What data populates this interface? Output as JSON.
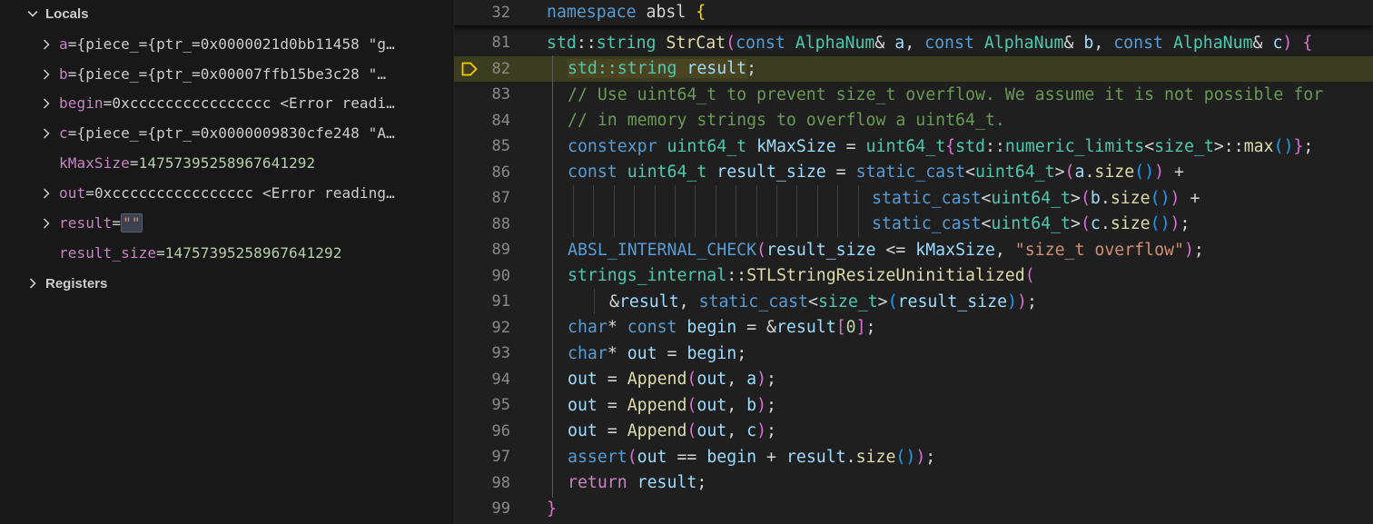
{
  "variables": {
    "locals_label": "Locals",
    "registers_label": "Registers",
    "rows": [
      {
        "name": "a",
        "eq": " = ",
        "value": "{piece_={ptr_=0x0000021d0bb11458 \"g…",
        "expandable": true
      },
      {
        "name": "b",
        "eq": " = ",
        "value": "{piece_={ptr_=0x00007ffb15be3c28 \"…",
        "expandable": true
      },
      {
        "name": "begin",
        "eq": " = ",
        "value": "0xcccccccccccccccc <Error readi…",
        "expandable": true
      },
      {
        "name": "c",
        "eq": " = ",
        "value": "{piece_={ptr_=0x0000009830cfe248 \"A…",
        "expandable": true
      },
      {
        "name": "kMaxSize",
        "eq": " = ",
        "value": "14757395258967641292",
        "expandable": false
      },
      {
        "name": "out",
        "eq": " = ",
        "value": "0xcccccccccccccccc <Error reading…",
        "expandable": true
      },
      {
        "name": "result",
        "eq": " = ",
        "value": "\"\"",
        "expandable": true
      },
      {
        "name": "result_size",
        "eq": " = ",
        "value": "14757395258967641292",
        "expandable": false
      }
    ]
  },
  "editor": {
    "sticky": {
      "num": "32",
      "t": [
        "namespace",
        " absl ",
        "{"
      ]
    },
    "lines": [
      {
        "num": "81"
      },
      {
        "num": "82"
      },
      {
        "num": "83"
      },
      {
        "num": "84"
      },
      {
        "num": "85"
      },
      {
        "num": "86"
      },
      {
        "num": "87"
      },
      {
        "num": "88"
      },
      {
        "num": "89"
      },
      {
        "num": "90"
      },
      {
        "num": "91"
      },
      {
        "num": "92"
      },
      {
        "num": "93"
      },
      {
        "num": "94"
      },
      {
        "num": "95"
      },
      {
        "num": "96"
      },
      {
        "num": "97"
      },
      {
        "num": "98"
      },
      {
        "num": "99"
      }
    ],
    "code": {
      "l81": [
        "std",
        "::",
        "string",
        " ",
        "StrCat",
        "(",
        "const",
        " ",
        "AlphaNum",
        "& ",
        "a",
        ", ",
        "const",
        " ",
        "AlphaNum",
        "& ",
        "b",
        ", ",
        "const",
        " ",
        "AlphaNum",
        "& ",
        "c",
        ") ",
        "{"
      ],
      "l82": [
        "std::string",
        " ",
        "result",
        ";"
      ],
      "l83": [
        "// Use uint64_t to prevent size_t overflow. We assume it is not possible for"
      ],
      "l84": [
        "// in memory strings to overflow a uint64_t."
      ],
      "l85": [
        "constexpr",
        " ",
        "uint64_t",
        " ",
        "kMaxSize",
        " = ",
        "uint64_t",
        "{",
        "std",
        "::",
        "numeric_limits",
        "<",
        "size_t",
        ">::",
        "max",
        "()",
        "}",
        ";"
      ],
      "l86": [
        "const",
        " ",
        "uint64_t",
        " ",
        "result_size",
        " = ",
        "static_cast",
        "<",
        "uint64_t",
        ">",
        "(",
        "a",
        ".",
        "size",
        "()",
        ")",
        " +"
      ],
      "l87": [
        "static_cast",
        "<",
        "uint64_t",
        ">",
        "(",
        "b",
        ".",
        "size",
        "()",
        ")",
        " +"
      ],
      "l88": [
        "static_cast",
        "<",
        "uint64_t",
        ">",
        "(",
        "c",
        ".",
        "size",
        "()",
        ")",
        ";"
      ],
      "l89": [
        "ABSL_INTERNAL_CHECK",
        "(",
        "result_size",
        " <= ",
        "kMaxSize",
        ", ",
        "\"size_t overflow\"",
        ")",
        ";"
      ],
      "l90": [
        "strings_internal",
        "::",
        "STLStringResizeUninitialized",
        "("
      ],
      "l91": [
        "&",
        "result",
        ", ",
        "static_cast",
        "<",
        "size_t",
        ">",
        "(",
        "result_size",
        ")",
        ")",
        ";"
      ],
      "l92": [
        "char",
        "* ",
        "const",
        " ",
        "begin",
        " = &",
        "result",
        "[",
        "0",
        "]",
        ";"
      ],
      "l93": [
        "char",
        "* ",
        "out",
        " = ",
        "begin",
        ";"
      ],
      "l94": [
        "out",
        " = ",
        "Append",
        "(",
        "out",
        ", ",
        "a",
        ")",
        ";"
      ],
      "l95": [
        "out",
        " = ",
        "Append",
        "(",
        "out",
        ", ",
        "b",
        ")",
        ";"
      ],
      "l96": [
        "out",
        " = ",
        "Append",
        "(",
        "out",
        ", ",
        "c",
        ")",
        ";"
      ],
      "l97": [
        "assert",
        "(",
        "out",
        " == ",
        "begin",
        " + ",
        "result",
        ".",
        "size",
        "()",
        ")",
        ";"
      ],
      "l98": [
        "return",
        " ",
        "result",
        ";"
      ],
      "l99": [
        "}"
      ]
    },
    "current_line": "82",
    "colors": {
      "current_line_bg": "#3a3d1f",
      "current_token_bg": "#4b4420",
      "arrow": "#ffcc00"
    }
  }
}
